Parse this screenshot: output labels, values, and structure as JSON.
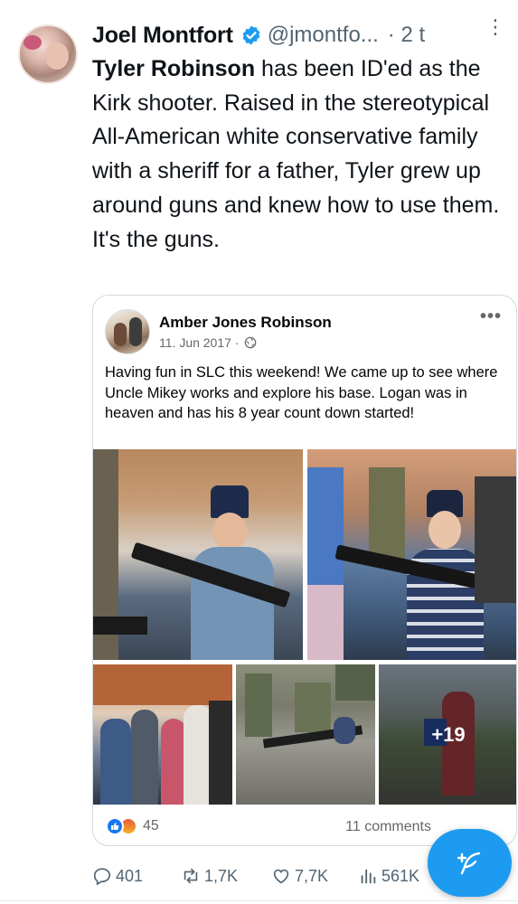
{
  "tweet": {
    "author_name": "Joel Montfort",
    "handle": "@jmontfo...",
    "time": "· 2 t",
    "text_bold": "Tyler Robinson",
    "text_rest": " has been ID'ed as the Kirk shooter. Raised in the stereotypical All-American white conservative family with a sheriff for a father, Tyler grew up around guns and knew how to use them.  It's the guns.",
    "verified_icon": "verified-badge-icon",
    "more_icon": "more-vertical-icon"
  },
  "embedded_post": {
    "author": "Amber Jones Robinson",
    "date": "11. Jun 2017 ·",
    "privacy_icon": "globe-icon",
    "text": "Having fun in SLC this weekend! We came up to see where Uncle Mikey works and explore his base. Logan was in heaven and has his 8 year count down started!",
    "more_photos": "+19",
    "reaction_count": "45",
    "comments": "11 comments",
    "colors": {
      "like": "#1877f2",
      "angry": "#e9573d"
    }
  },
  "actions": {
    "replies": "401",
    "reposts": "1,7K",
    "likes": "7,7K",
    "views": "561K"
  },
  "colors": {
    "accent": "#1d9bf0",
    "muted": "#536471"
  }
}
